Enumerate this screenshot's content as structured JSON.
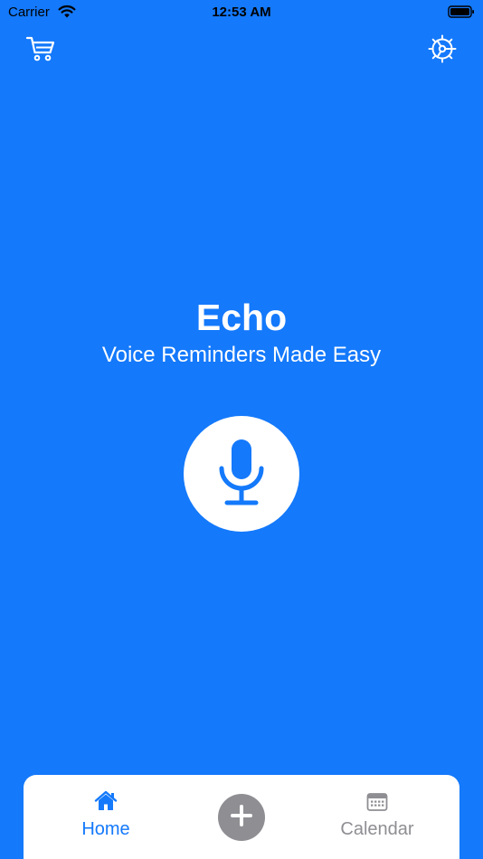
{
  "status_bar": {
    "carrier": "Carrier",
    "time": "12:53 AM",
    "wifi_icon": "wifi-icon",
    "battery_icon": "battery-icon"
  },
  "header": {
    "cart_icon": "cart-icon",
    "settings_icon": "gear-icon"
  },
  "hero": {
    "title": "Echo",
    "subtitle": "Voice Reminders Made Easy",
    "mic_icon": "microphone-icon"
  },
  "tab_bar": {
    "tabs": [
      {
        "label": "Home",
        "icon": "home-icon",
        "selected": true
      },
      {
        "label": "Calendar",
        "icon": "calendar-icon",
        "selected": false
      }
    ],
    "add_icon": "plus-icon"
  },
  "colors": {
    "background": "#1479FB",
    "tab_active": "#1479FB",
    "tab_inactive": "#8E8E93",
    "surface": "#FFFFFF"
  }
}
